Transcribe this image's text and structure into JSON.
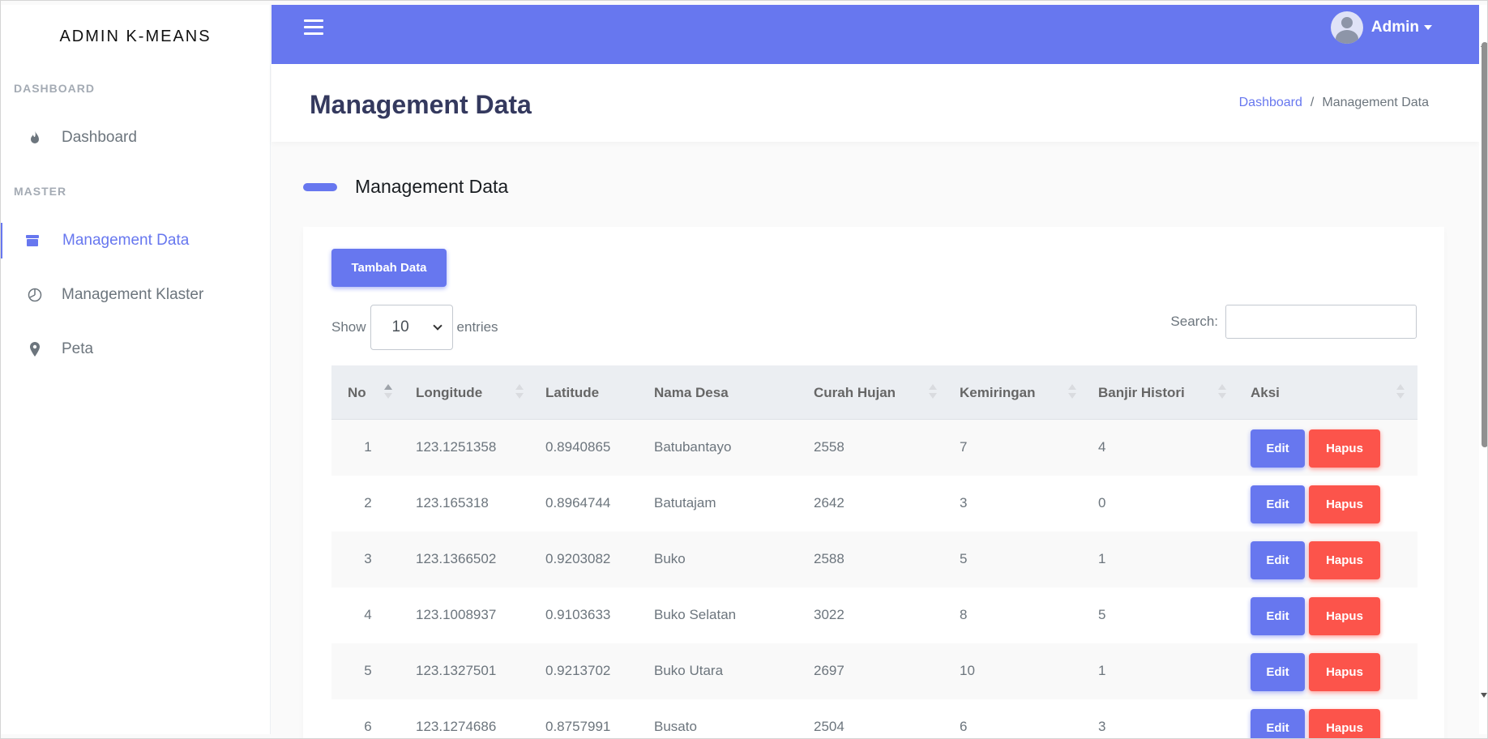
{
  "brand": "ADMIN K-MEANS",
  "sidebar": {
    "groups": [
      {
        "heading": "DASHBOARD"
      },
      {
        "heading": "MASTER"
      }
    ],
    "items": [
      {
        "label": "Dashboard",
        "icon": "fire-icon"
      },
      {
        "label": "Management Data",
        "icon": "box-icon"
      },
      {
        "label": "Management Klaster",
        "icon": "pie-chart-icon"
      },
      {
        "label": "Peta",
        "icon": "map-marker-icon"
      }
    ]
  },
  "navbar": {
    "user_name": "Admin"
  },
  "header": {
    "title": "Management Data",
    "breadcrumb": [
      "Dashboard",
      "/",
      "Management Data"
    ]
  },
  "section": {
    "title": "Management Data"
  },
  "toolbar": {
    "add_label": "Tambah Data",
    "show_label": "Show",
    "entries_value": "10",
    "entries_label": "entries",
    "search_label": "Search:",
    "search_value": ""
  },
  "table": {
    "columns": [
      "No",
      "Longitude",
      "Latitude",
      "Nama Desa",
      "Curah Hujan",
      "Kemiringan",
      "Banjir Histori",
      "Aksi"
    ],
    "edit_label": "Edit",
    "delete_label": "Hapus",
    "rows": [
      [
        "1",
        "123.1251358",
        "0.8940865",
        "Batubantayo",
        "2558",
        "7",
        "4"
      ],
      [
        "2",
        "123.165318",
        "0.8964744",
        "Batutajam",
        "2642",
        "3",
        "0"
      ],
      [
        "3",
        "123.1366502",
        "0.9203082",
        "Buko",
        "2588",
        "5",
        "1"
      ],
      [
        "4",
        "123.1008937",
        "0.9103633",
        "Buko Selatan",
        "3022",
        "8",
        "5"
      ],
      [
        "5",
        "123.1327501",
        "0.9213702",
        "Buko Utara",
        "2697",
        "10",
        "1"
      ],
      [
        "6",
        "123.1274686",
        "0.8757991",
        "Busato",
        "2504",
        "6",
        "3"
      ]
    ]
  },
  "colors": {
    "primary": "#6777ef",
    "danger": "#fc544b"
  }
}
